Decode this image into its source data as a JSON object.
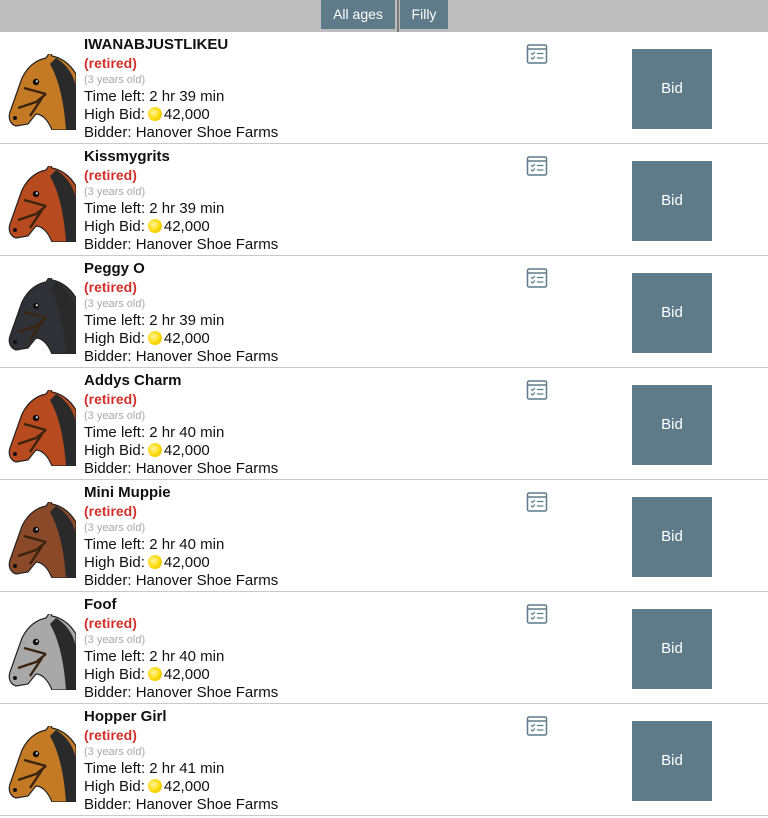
{
  "filters": {
    "age_label": "All ages",
    "sex_label": "Filly"
  },
  "colors": {
    "accent": "#5f7b89",
    "status": "#d2302c"
  },
  "labels": {
    "time_prefix": "Time left:",
    "bid_prefix": "High Bid:",
    "bidder_prefix": "Bidder:",
    "bid_button": "Bid"
  },
  "horses": [
    {
      "name": "IWANABJUSTLIKEU",
      "status": "(retired)",
      "age": "(3 years old)",
      "time_left": "2 hr 39 min",
      "high_bid": "42,000",
      "bidder": "Hanover Shoe Farms",
      "coat": "#c47a25"
    },
    {
      "name": "Kissmygrits",
      "status": "(retired)",
      "age": "(3 years old)",
      "time_left": "2 hr 39 min",
      "high_bid": "42,000",
      "bidder": "Hanover Shoe Farms",
      "coat": "#b74a1e"
    },
    {
      "name": "Peggy O",
      "status": "(retired)",
      "age": "(3 years old)",
      "time_left": "2 hr 39 min",
      "high_bid": "42,000",
      "bidder": "Hanover Shoe Farms",
      "coat": "#2e3236"
    },
    {
      "name": "Addys Charm",
      "status": "(retired)",
      "age": "(3 years old)",
      "time_left": "2 hr 40 min",
      "high_bid": "42,000",
      "bidder": "Hanover Shoe Farms",
      "coat": "#b74a1e"
    },
    {
      "name": "Mini Muppie",
      "status": "(retired)",
      "age": "(3 years old)",
      "time_left": "2 hr 40 min",
      "high_bid": "42,000",
      "bidder": "Hanover Shoe Farms",
      "coat": "#8a4a2a"
    },
    {
      "name": "Foof",
      "status": "(retired)",
      "age": "(3 years old)",
      "time_left": "2 hr 40 min",
      "high_bid": "42,000",
      "bidder": "Hanover Shoe Farms",
      "coat": "#a8a8a8"
    },
    {
      "name": "Hopper Girl",
      "status": "(retired)",
      "age": "(3 years old)",
      "time_left": "2 hr 41 min",
      "high_bid": "42,000",
      "bidder": "Hanover Shoe Farms",
      "coat": "#c47a25"
    }
  ]
}
